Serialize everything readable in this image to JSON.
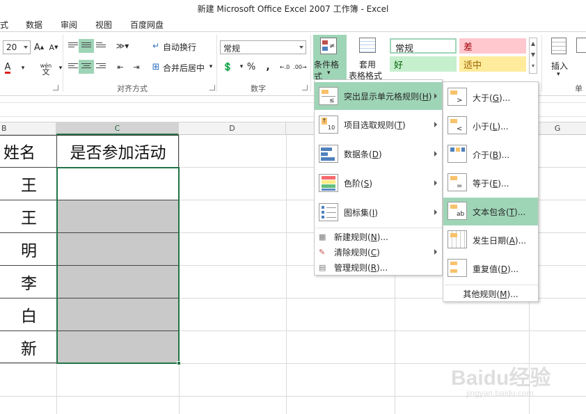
{
  "window": {
    "title": "新建 Microsoft Office Excel 2007 工作簿 - Excel"
  },
  "tabs": [
    "式",
    "数据",
    "审阅",
    "视图",
    "百度网盘"
  ],
  "ribbon": {
    "font_size": "20",
    "wrap_text": "自动换行",
    "merge_center": "合并后居中",
    "alignment_group": "对齐方式",
    "number_format": "常规",
    "number_group": "数字",
    "percent": "%",
    "comma": ",",
    "phonetic": "wén",
    "cond_format": "条件格式",
    "table_format_1": "套用",
    "table_format_2": "表格格式",
    "styles": {
      "normal": "常规",
      "bad": "差",
      "good": "好",
      "neutral": "适中"
    },
    "insert": "插入",
    "cells_group_partial": "单元"
  },
  "columns": [
    "B",
    "C",
    "D",
    "G"
  ],
  "cells": {
    "b1": "姓名",
    "c1": "是否参加活动",
    "b_values": [
      "王",
      "王",
      "明",
      "李",
      "白",
      "新"
    ]
  },
  "menu": {
    "items": [
      {
        "label": "突出显示单元格规则",
        "key": "H",
        "icon": "highlight-cells-icon"
      },
      {
        "label": "项目选取规则",
        "key": "T",
        "icon": "top-bottom-icon"
      },
      {
        "label": "数据条",
        "key": "D",
        "icon": "data-bars-icon"
      },
      {
        "label": "色阶",
        "key": "S",
        "icon": "color-scales-icon"
      },
      {
        "label": "图标集",
        "key": "I",
        "icon": "icon-sets-icon"
      }
    ],
    "small_items": [
      {
        "label": "新建规则",
        "key": "N",
        "suffix": "..."
      },
      {
        "label": "清除规则",
        "key": "C",
        "suffix": ""
      },
      {
        "label": "管理规则",
        "key": "R",
        "suffix": "..."
      }
    ]
  },
  "submenu": {
    "items": [
      {
        "label": "大于",
        "key": "G",
        "suffix": "...",
        "icon": "greater-than-icon"
      },
      {
        "label": "小于",
        "key": "L",
        "suffix": "...",
        "icon": "less-than-icon"
      },
      {
        "label": "介于",
        "key": "B",
        "suffix": "...",
        "icon": "between-icon"
      },
      {
        "label": "等于",
        "key": "E",
        "suffix": "...",
        "icon": "equal-to-icon"
      },
      {
        "label": "文本包含",
        "key": "T",
        "suffix": "...",
        "icon": "text-contains-icon"
      },
      {
        "label": "发生日期",
        "key": "A",
        "suffix": "...",
        "icon": "date-occurring-icon"
      },
      {
        "label": "重复值",
        "key": "D",
        "suffix": "...",
        "icon": "duplicate-values-icon"
      }
    ],
    "more": {
      "label": "其他规则",
      "key": "M",
      "suffix": "..."
    }
  },
  "watermark": {
    "brand": "Baidu经验",
    "url": "jingyan.baidu.com"
  },
  "colors": {
    "accent": "#217346",
    "highlight": "#9fd5b7",
    "bad_bg": "#ffc7ce",
    "good_bg": "#c6efce",
    "neutral_bg": "#ffeb9c"
  }
}
